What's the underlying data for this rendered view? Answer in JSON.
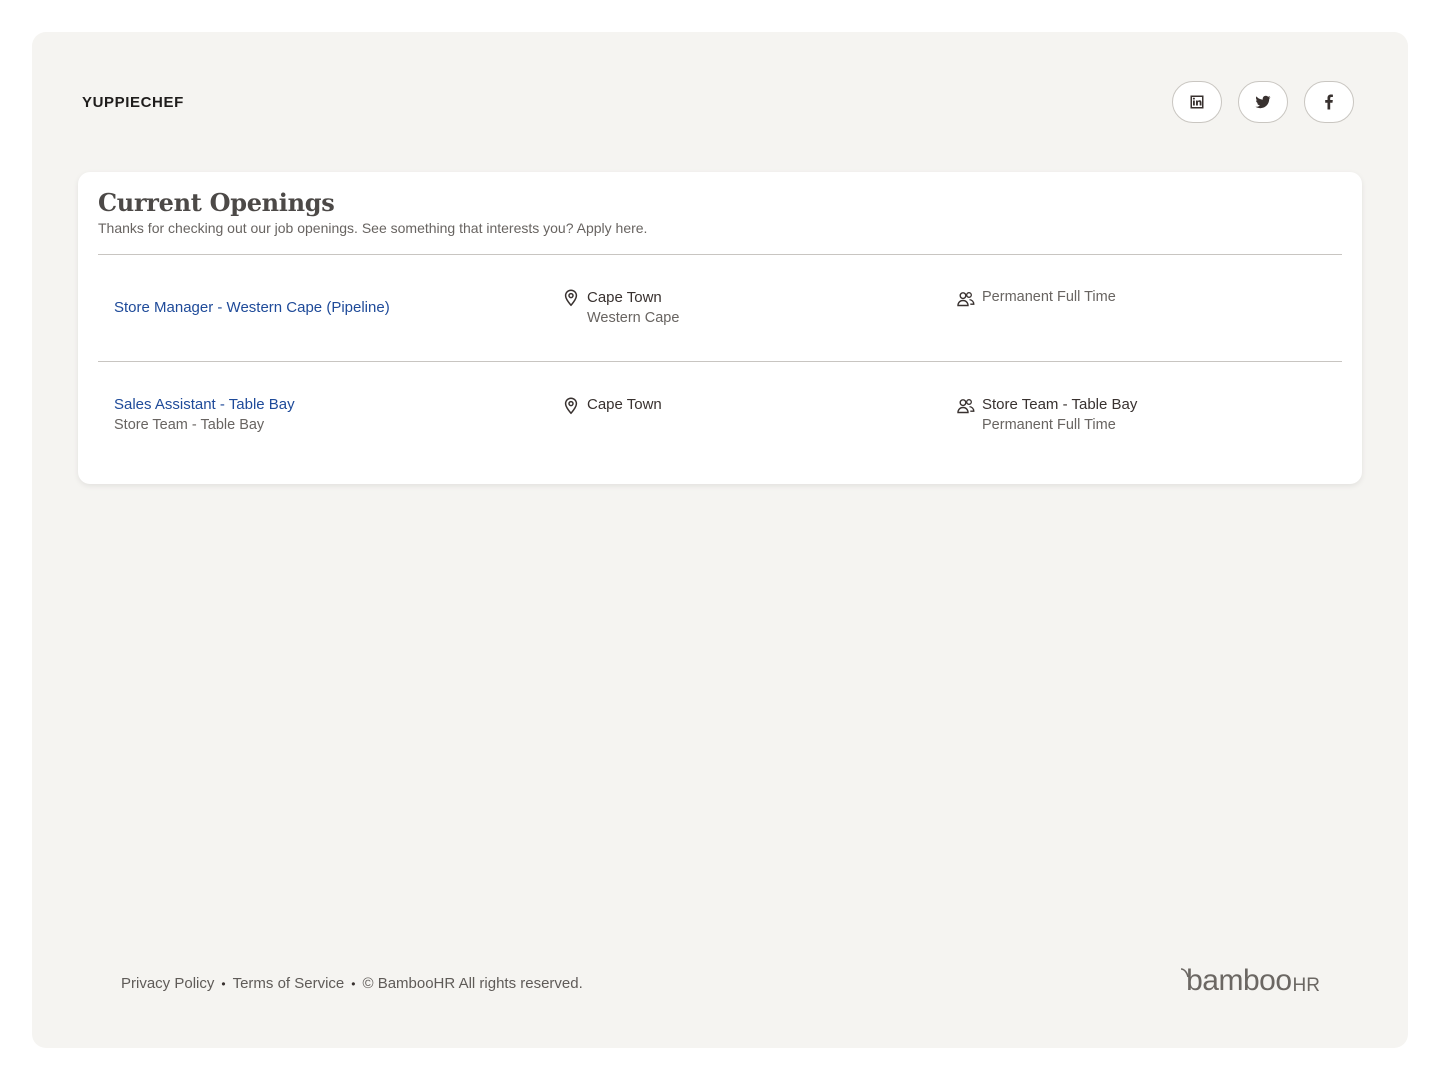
{
  "header": {
    "company_name": "YUPPIECHEF",
    "social": [
      {
        "name": "linkedin",
        "icon": "linkedin-icon"
      },
      {
        "name": "twitter",
        "icon": "twitter-icon"
      },
      {
        "name": "facebook",
        "icon": "facebook-icon"
      }
    ]
  },
  "openings": {
    "title": "Current Openings",
    "subtitle": "Thanks for checking out our job openings. See something that interests you? Apply here.",
    "jobs": [
      {
        "title": "Store Manager - Western Cape (Pipeline)",
        "department": "",
        "city": "Cape Town",
        "region": "Western Cape",
        "team_primary": "Permanent Full Time",
        "team_secondary": ""
      },
      {
        "title": "Sales Assistant - Table Bay",
        "department": "Store Team - Table Bay",
        "city": "Cape Town",
        "region": "",
        "team_primary": "Store Team - Table Bay",
        "team_secondary": "Permanent Full Time"
      }
    ]
  },
  "footer": {
    "privacy": "Privacy Policy",
    "terms": "Terms of Service",
    "separator": "•",
    "copyright": "© BambooHR All rights reserved.",
    "brand_word": "bamboo",
    "brand_suffix": "HR"
  },
  "colors": {
    "page_bg": "#f5f4f1",
    "card_bg": "#ffffff",
    "link": "#1e4a99",
    "text_muted": "#686461"
  }
}
